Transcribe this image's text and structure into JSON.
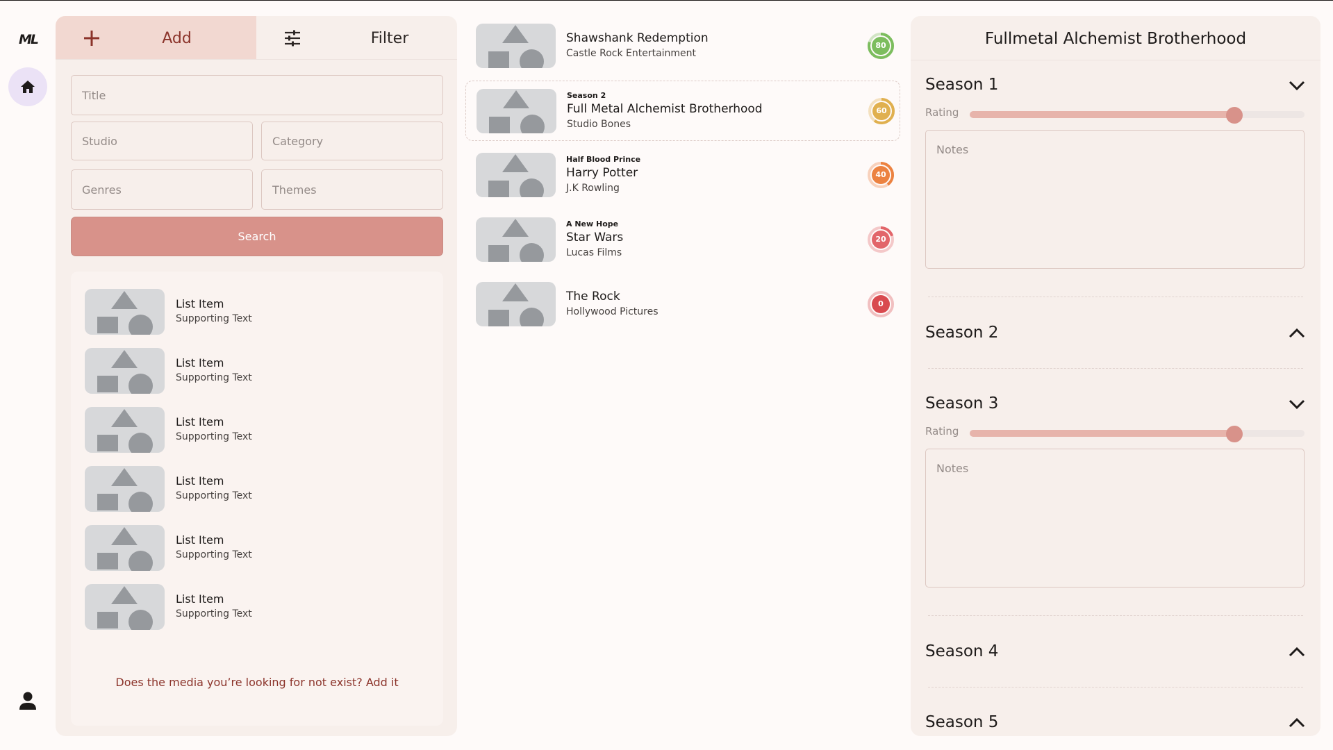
{
  "rail": {
    "logo": "ML",
    "home_icon": "home-icon",
    "profile_icon": "person-icon"
  },
  "left_panel": {
    "tabs": [
      {
        "label": "Add",
        "icon": "plus-icon",
        "active": true
      },
      {
        "label": "Filter",
        "icon": "tune-icon",
        "active": false
      }
    ],
    "fields": {
      "title": "Title",
      "studio": "Studio",
      "category": "Category",
      "genres": "Genres",
      "themes": "Themes"
    },
    "search_label": "Search",
    "results": [
      {
        "title": "List Item",
        "subtitle": "Supporting Text"
      },
      {
        "title": "List Item",
        "subtitle": "Supporting Text"
      },
      {
        "title": "List Item",
        "subtitle": "Supporting Text"
      },
      {
        "title": "List Item",
        "subtitle": "Supporting Text"
      },
      {
        "title": "List Item",
        "subtitle": "Supporting Text"
      },
      {
        "title": "List Item",
        "subtitle": "Supporting Text"
      }
    ],
    "add_link": "Does the media you’re looking for not exist? Add it"
  },
  "media_list": [
    {
      "overline": "",
      "title": "Shawshank Redemption",
      "subtitle": "Castle Rock Entertainment",
      "score": "80",
      "progress": 0.8,
      "color": "#7cbd5e",
      "selected": false
    },
    {
      "overline": "Season 2",
      "title": "Full Metal Alchemist Brotherhood",
      "subtitle": "Studio Bones",
      "score": "60",
      "progress": 0.6,
      "color": "#e0b04f",
      "selected": true
    },
    {
      "overline": "Half Blood Prince",
      "title": "Harry Potter",
      "subtitle": "J.K Rowling",
      "score": "40",
      "progress": 0.4,
      "color": "#ec8241",
      "selected": false
    },
    {
      "overline": "A New Hope",
      "title": "Star Wars",
      "subtitle": "Lucas Films",
      "score": "20",
      "progress": 0.2,
      "color": "#e2656a",
      "selected": false
    },
    {
      "overline": "",
      "title": "The Rock",
      "subtitle": "Hollywood Pictures",
      "score": "0",
      "progress": 0.0,
      "color": "#d94a4f",
      "selected": false
    }
  ],
  "detail": {
    "title": "Fullmetal Alchemist Brotherhood",
    "rating_label": "Rating",
    "notes_placeholder": "Notes",
    "seasons": [
      {
        "label": "Season 1",
        "expanded": true,
        "rating": 0.79
      },
      {
        "label": "Season 2",
        "expanded": false
      },
      {
        "label": "Season 3",
        "expanded": true,
        "rating": 0.79
      },
      {
        "label": "Season 4",
        "expanded": false
      },
      {
        "label": "Season 5",
        "expanded": false
      }
    ]
  },
  "colors": {
    "accent": "#d8928a",
    "accent_dark": "#8b332a",
    "panel": "#f7efeb"
  }
}
